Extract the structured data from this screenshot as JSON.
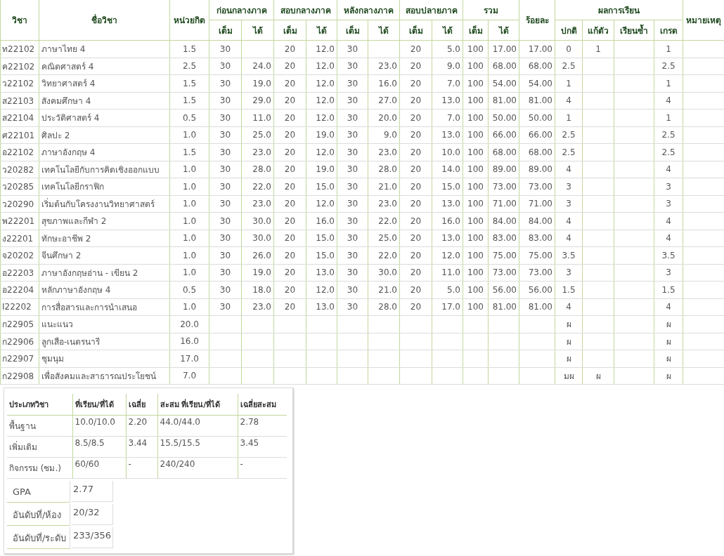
{
  "grades_table": {
    "group_headers": [
      {
        "label": "วิชา",
        "kind": "single"
      },
      {
        "label": "ชื่อวิชา",
        "kind": "single"
      },
      {
        "label": "หน่วยกิต",
        "kind": "single"
      },
      {
        "label": "ก่อนกลางภาค",
        "kind": "pair"
      },
      {
        "label": "สอบกลางภาค",
        "kind": "pair"
      },
      {
        "label": "หลังกลางภาค",
        "kind": "pair"
      },
      {
        "label": "สอบปลายภาค",
        "kind": "pair"
      },
      {
        "label": "รวม",
        "kind": "pair"
      },
      {
        "label": "ร้อยละ",
        "kind": "single"
      },
      {
        "label": "ผลการเรียน",
        "kind": "quad"
      },
      {
        "label": "หมายเหตุ",
        "kind": "single"
      }
    ],
    "sub_headers": [
      "เต็ม",
      "ได้",
      "เต็ม",
      "ได้",
      "เต็ม",
      "ได้",
      "เต็ม",
      "ได้",
      "เต็ม",
      "ได้",
      "ปกติ",
      "แก้ตัว",
      "เรียนซ้ำ",
      "เกรด"
    ],
    "rows": [
      {
        "code": "ท22102",
        "name": "ภาษาไทย  4",
        "cells": [
          "1.5",
          "30",
          null,
          "20",
          "12.0",
          "30",
          null,
          "20",
          "5.0",
          "100",
          "17.00",
          "17.00",
          "0",
          "1",
          null,
          "1",
          null
        ]
      },
      {
        "code": "ค22102",
        "name": "คณิตศาสตร์  4",
        "cells": [
          "2.5",
          "30",
          "24.0",
          "20",
          "12.0",
          "30",
          "23.0",
          "20",
          "9.0",
          "100",
          "68.00",
          "68.00",
          "2.5",
          null,
          null,
          "2.5",
          null
        ]
      },
      {
        "code": "ว22102",
        "name": "วิทยาศาสตร์  4",
        "cells": [
          "1.5",
          "30",
          "19.0",
          "20",
          "12.0",
          "30",
          "16.0",
          "20",
          "7.0",
          "100",
          "54.00",
          "54.00",
          "1",
          null,
          null,
          "1",
          null
        ]
      },
      {
        "code": "ส22103",
        "name": "สังคมศึกษา  4",
        "cells": [
          "1.5",
          "30",
          "29.0",
          "20",
          "12.0",
          "30",
          "27.0",
          "20",
          "13.0",
          "100",
          "81.00",
          "81.00",
          "4",
          null,
          null,
          "4",
          null
        ]
      },
      {
        "code": "ส22104",
        "name": "ประวัติศาสตร์  4",
        "cells": [
          "0.5",
          "30",
          "11.0",
          "20",
          "12.0",
          "30",
          "20.0",
          "20",
          "7.0",
          "100",
          "50.00",
          "50.00",
          "1",
          null,
          null,
          "1",
          null
        ]
      },
      {
        "code": "ศ22101",
        "name": "ศิลปะ  2",
        "cells": [
          "1.0",
          "30",
          "25.0",
          "20",
          "19.0",
          "30",
          "9.0",
          "20",
          "13.0",
          "100",
          "66.00",
          "66.00",
          "2.5",
          null,
          null,
          "2.5",
          null
        ]
      },
      {
        "code": "อ22102",
        "name": "ภาษาอังกฤษ  4",
        "cells": [
          "1.5",
          "30",
          "23.0",
          "20",
          "12.0",
          "30",
          "23.0",
          "20",
          "10.0",
          "100",
          "68.00",
          "68.00",
          "2.5",
          null,
          null,
          "2.5",
          null
        ]
      },
      {
        "code": "ว20282",
        "name": "เทคโนโลยีกับการคิดเชิงออกแบบ",
        "cells": [
          "1.0",
          "30",
          "28.0",
          "20",
          "19.0",
          "30",
          "28.0",
          "20",
          "14.0",
          "100",
          "89.00",
          "89.00",
          "4",
          null,
          null,
          "4",
          null
        ]
      },
      {
        "code": "ว20285",
        "name": "เทคโนโลยีกราฟิก",
        "cells": [
          "1.0",
          "30",
          "22.0",
          "20",
          "15.0",
          "30",
          "21.0",
          "20",
          "15.0",
          "100",
          "73.00",
          "73.00",
          "3",
          null,
          null,
          "3",
          null
        ]
      },
      {
        "code": "ว20290",
        "name": "เริ่มต้นกับโครงงานวิทยาศาสตร์",
        "cells": [
          "1.0",
          "30",
          "23.0",
          "20",
          "12.0",
          "30",
          "23.0",
          "20",
          "13.0",
          "100",
          "71.00",
          "71.00",
          "3",
          null,
          null,
          "3",
          null
        ]
      },
      {
        "code": "พ22201",
        "name": "สุขภาพและกีฬา  2",
        "cells": [
          "1.0",
          "30",
          "30.0",
          "20",
          "16.0",
          "30",
          "22.0",
          "20",
          "16.0",
          "100",
          "84.00",
          "84.00",
          "4",
          null,
          null,
          "4",
          null
        ]
      },
      {
        "code": "ง22201",
        "name": "ทักษะอาชีพ  2",
        "cells": [
          "1.0",
          "30",
          "30.0",
          "20",
          "15.0",
          "30",
          "25.0",
          "20",
          "13.0",
          "100",
          "83.00",
          "83.00",
          "4",
          null,
          null,
          "4",
          null
        ]
      },
      {
        "code": "จ20202",
        "name": "จีนศึกษา  2",
        "cells": [
          "1.0",
          "30",
          "26.0",
          "20",
          "15.0",
          "30",
          "22.0",
          "20",
          "12.0",
          "100",
          "75.00",
          "75.00",
          "3.5",
          null,
          null,
          "3.5",
          null
        ]
      },
      {
        "code": "อ22203",
        "name": "ภาษาอังกฤษอ่าน  -  เขียน  2",
        "cells": [
          "1.0",
          "30",
          "19.0",
          "20",
          "13.0",
          "30",
          "30.0",
          "20",
          "11.0",
          "100",
          "73.00",
          "73.00",
          "3",
          null,
          null,
          "3",
          null
        ]
      },
      {
        "code": "อ22204",
        "name": "หลักภาษาอังกฤษ  4",
        "cells": [
          "0.5",
          "30",
          "18.0",
          "20",
          "12.0",
          "30",
          "21.0",
          "20",
          "5.0",
          "100",
          "56.00",
          "56.00",
          "1.5",
          null,
          null,
          "1.5",
          null
        ]
      },
      {
        "code": "I22202",
        "name": "การสื่อสารและการนำเสนอ",
        "cells": [
          "1.0",
          "30",
          "23.0",
          "20",
          "13.0",
          "30",
          "28.0",
          "20",
          "17.0",
          "100",
          "81.00",
          "81.00",
          "4",
          null,
          null,
          "4",
          null
        ]
      },
      {
        "code": "ก22905",
        "name": "แนะแนว",
        "cells": [
          "20.0",
          null,
          null,
          null,
          null,
          null,
          null,
          null,
          null,
          null,
          null,
          null,
          "ผ",
          null,
          null,
          "ผ",
          null
        ]
      },
      {
        "code": "ก22906",
        "name": "ลูกเสือ-เนตรนารี",
        "cells": [
          "16.0",
          null,
          null,
          null,
          null,
          null,
          null,
          null,
          null,
          null,
          null,
          null,
          "ผ",
          null,
          null,
          "ผ",
          null
        ]
      },
      {
        "code": "ก22907",
        "name": "ชุมนุม",
        "cells": [
          "17.0",
          null,
          null,
          null,
          null,
          null,
          null,
          null,
          null,
          null,
          null,
          null,
          "ผ",
          null,
          null,
          "ผ",
          null
        ]
      },
      {
        "code": "ก22908",
        "name": "เพื่อสังคมและสาธารณประโยชน์",
        "cells": [
          "7.0",
          null,
          null,
          null,
          null,
          null,
          null,
          null,
          null,
          null,
          null,
          null,
          "มผ",
          "ผ",
          null,
          "ผ",
          null
        ]
      }
    ]
  },
  "summary": {
    "columns": [
      "ประเภทวิชา",
      "ที่เรียน/ที่ได้",
      "เฉลี่ย",
      "สะสม  ที่เรียน/ที่ได้",
      "เฉลี่ยสะสม"
    ],
    "rows": [
      [
        "พื้นฐาน",
        "10.0/10.0",
        "2.20",
        "44.0/44.0",
        "2.78"
      ],
      [
        "เพิ่มเติม",
        "8.5/8.5",
        "3.44",
        "15.5/15.5",
        "3.45"
      ],
      [
        "กิจกรรม  (ชม.)",
        "60/60",
        "-",
        "240/240",
        "-"
      ]
    ],
    "stats": [
      {
        "label": "GPA",
        "value": "2.77"
      },
      {
        "label": "อันดับที่/ห้อง",
        "value": "20/32"
      },
      {
        "label": "อันดับที่/ระดับ",
        "value": "233/356"
      }
    ]
  }
}
